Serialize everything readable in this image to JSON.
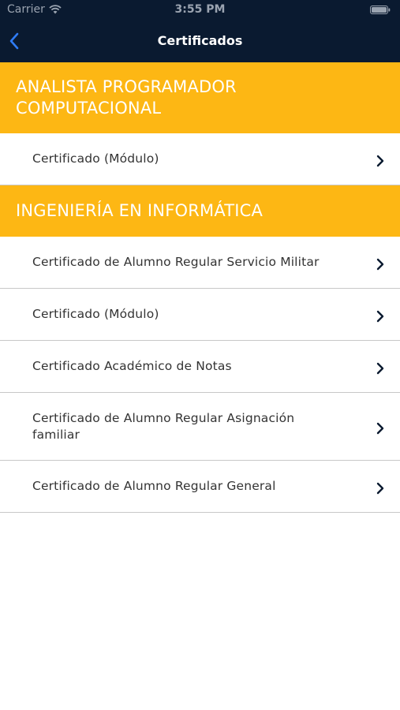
{
  "status_bar": {
    "carrier": "Carrier",
    "time": "3:55 PM"
  },
  "nav": {
    "title": "Certificados",
    "back_icon": "chevron-left-icon"
  },
  "colors": {
    "navy": "#0a1a30",
    "section_yellow": "#fdb714",
    "back_blue": "#2f7cf6"
  },
  "sections": [
    {
      "title_line1": "ANALISTA PROGRAMADOR",
      "title_line2": "COMPUTACIONAL",
      "items": [
        {
          "label": "Certificado (Módulo)"
        }
      ]
    },
    {
      "title_line1": "INGENIERÍA EN INFORMÁTICA",
      "items": [
        {
          "label": "Certificado de Alumno Regular Servicio Militar"
        },
        {
          "label": "Certificado (Módulo)"
        },
        {
          "label": "Certificado Académico de Notas"
        },
        {
          "label_line1": "Certificado de Alumno Regular Asignación",
          "label_line2": "familiar"
        },
        {
          "label": "Certificado de Alumno Regular General"
        }
      ]
    }
  ]
}
